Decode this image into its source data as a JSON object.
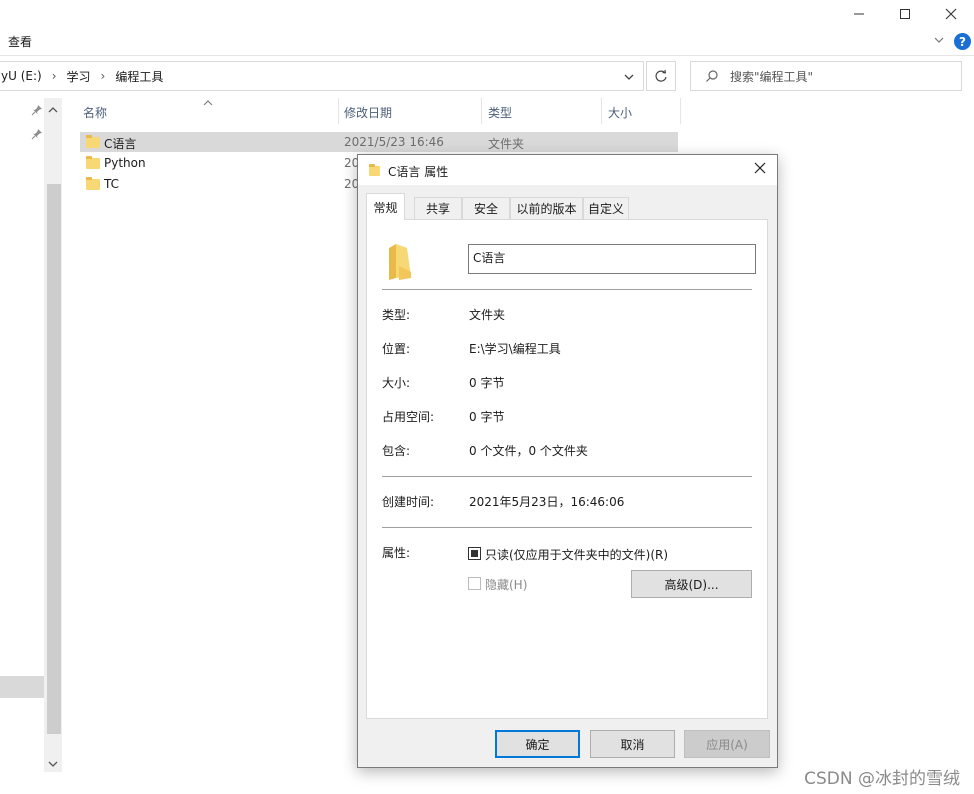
{
  "ribbon": {
    "view_label": "查看"
  },
  "address": {
    "drive": "yU (E:)",
    "folder1": "学习",
    "folder2": "编程工具",
    "separator": "›"
  },
  "search": {
    "placeholder": "搜索\"编程工具\""
  },
  "list": {
    "columns": {
      "name": "名称",
      "modified": "修改日期",
      "type": "类型",
      "size": "大小"
    },
    "rows": [
      {
        "name": "C语言",
        "modified": "2021/5/23 16:46",
        "type": "文件夹"
      },
      {
        "name": "Python",
        "modified": "20"
      },
      {
        "name": "TC",
        "modified": "20"
      }
    ]
  },
  "dialog": {
    "title": "C语言 属性",
    "tabs": [
      "常规",
      "共享",
      "安全",
      "以前的版本",
      "自定义"
    ],
    "name_value": "C语言",
    "type_label": "类型:",
    "type_value": "文件夹",
    "location_label": "位置:",
    "location_value": "E:\\学习\\编程工具",
    "size_label": "大小:",
    "size_value": "0 字节",
    "disk_label": "占用空间:",
    "disk_value": "0 字节",
    "contains_label": "包含:",
    "contains_value": "0 个文件，0 个文件夹",
    "created_label": "创建时间:",
    "created_value": "2021年5月23日，16:46:06",
    "attr_label": "属性:",
    "readonly_label": "只读(仅应用于文件夹中的文件)(R)",
    "hidden_label": "隐藏(H)",
    "advanced_label": "高级(D)...",
    "ok_label": "确定",
    "cancel_label": "取消",
    "apply_label": "应用(A)"
  },
  "watermark": "CSDN @冰封的雪绒",
  "colors": {
    "accent": "#0078d7",
    "folder": "#f8d775",
    "help": "#1a6fd6"
  },
  "icons": [
    "minimize-icon",
    "maximize-icon",
    "close-icon",
    "expand-ribbon-icon",
    "help-icon",
    "chevron-down-icon",
    "refresh-icon",
    "search-icon",
    "pin-icon",
    "sort-up-icon",
    "folder-icon",
    "scroll-down-icon",
    "scroll-up-icon"
  ]
}
